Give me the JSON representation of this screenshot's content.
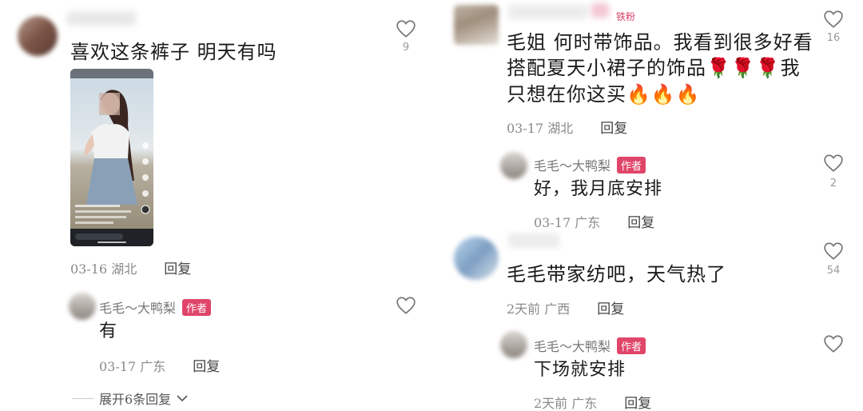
{
  "left": {
    "comment1": {
      "text": "喜欢这条裤子 明天有吗",
      "date": "03-16",
      "location": "湖北",
      "reply_label": "回复",
      "likes": "9"
    },
    "reply1": {
      "author": "毛毛～大鸭梨",
      "badge": "作者",
      "text": "有",
      "date": "03-17",
      "location": "广东",
      "reply_label": "回复"
    },
    "expand_label": "展开6条回复"
  },
  "right": {
    "comment1": {
      "fan_badge": "铁粉",
      "text_lines": [
        "毛姐 何时带饰品。我看到很多好看",
        "搭配夏天小裙子的饰品🌹🌹🌹我",
        "只想在你这买🔥🔥🔥"
      ],
      "date": "03-17",
      "location": "湖北",
      "reply_label": "回复",
      "likes": "16"
    },
    "reply1": {
      "author": "毛毛～大鸭梨",
      "badge": "作者",
      "text": "好，我月底安排",
      "date": "03-17",
      "location": "广东",
      "reply_label": "回复",
      "likes": "2"
    },
    "comment2": {
      "text": "毛毛带家纺吧，天气热了",
      "date": "2天前",
      "location": "广西",
      "reply_label": "回复",
      "likes": "54"
    },
    "reply2": {
      "author": "毛毛～大鸭梨",
      "badge": "作者",
      "text": "下场就安排",
      "date": "2天前",
      "location": "广东",
      "reply_label": "回复"
    }
  },
  "icons": {
    "like": "heart-outline-icon",
    "expand": "chevron-down-icon"
  },
  "colors": {
    "author_badge": "#e0466a",
    "fan_badge": "#d9406a"
  }
}
